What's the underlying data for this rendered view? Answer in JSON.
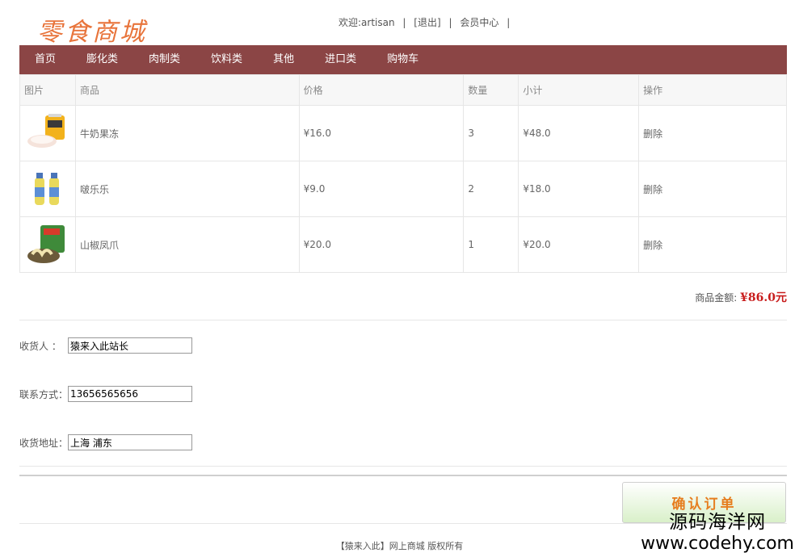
{
  "logo": "零食商城",
  "top": {
    "welcome": "欢迎:artisan",
    "sep1": "|",
    "logout": "[退出]",
    "sep2": "|",
    "member": "会员中心",
    "sep3": "|"
  },
  "nav": [
    "首页",
    "膨化类",
    "肉制类",
    "饮料类",
    "其他",
    "进口类",
    "购物车"
  ],
  "table": {
    "headers": [
      "图片",
      "商品",
      "价格",
      "数量",
      "小计",
      "操作"
    ],
    "rows": [
      {
        "name": "牛奶果冻",
        "price": "¥16.0",
        "qty": "3",
        "subtotal": "¥48.0",
        "action": "删除"
      },
      {
        "name": "啵乐乐",
        "price": "¥9.0",
        "qty": "2",
        "subtotal": "¥18.0",
        "action": "删除"
      },
      {
        "name": "山椒凤爪",
        "price": "¥20.0",
        "qty": "1",
        "subtotal": "¥20.0",
        "action": "删除"
      }
    ]
  },
  "total": {
    "label": "商品金额:",
    "amount": "¥86.0元"
  },
  "form": {
    "receiver_label": "收货人  ：",
    "receiver_value": "猿来入此站长",
    "phone_label": "联系方式：",
    "phone_value": "13656565656",
    "address_label": "收货地址：",
    "address_value": "上海 浦东"
  },
  "confirm": "确认订单",
  "footer": "【猿来入此】网上商城 版权所有",
  "watermark": {
    "line1": "源码海洋网",
    "line2": "www.codehy.com"
  },
  "colors": {
    "nav_bg": "#8b4545",
    "logo": "#e8743b",
    "total": "#c81c1c",
    "confirm_text": "#e67e1f"
  }
}
